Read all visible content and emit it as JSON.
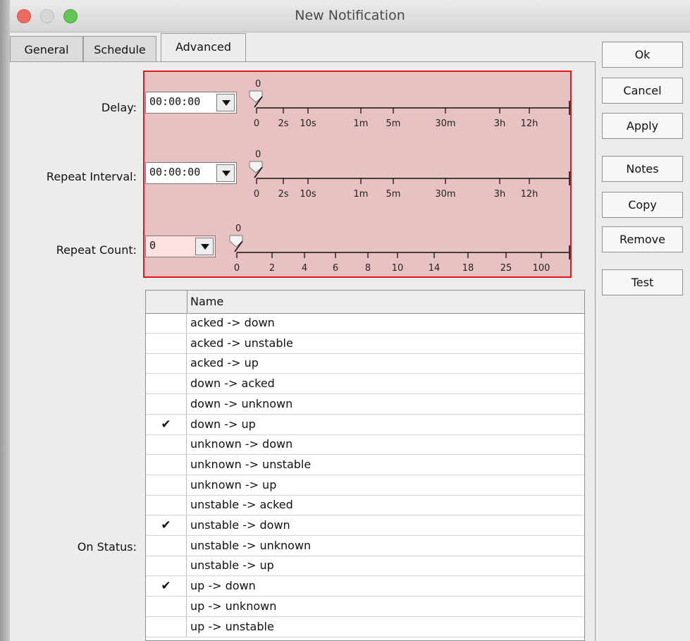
{
  "window": {
    "title": "New Notification"
  },
  "tabs": [
    "General",
    "Schedule",
    "Advanced"
  ],
  "buttons": {
    "ok": "Ok",
    "cancel": "Cancel",
    "apply": "Apply",
    "notes": "Notes",
    "copy": "Copy",
    "remove": "Remove",
    "test": "Test"
  },
  "fields": {
    "delay": {
      "label": "Delay:",
      "value": "00:00:00",
      "slider_value": "0",
      "ticks": [
        "0",
        "2s",
        "10s",
        "1m",
        "5m",
        "30m",
        "3h",
        "12h"
      ]
    },
    "repeat_interval": {
      "label": "Repeat Interval:",
      "value": "00:00:00",
      "slider_value": "0",
      "ticks": [
        "0",
        "2s",
        "10s",
        "1m",
        "5m",
        "30m",
        "3h",
        "12h"
      ]
    },
    "repeat_count": {
      "label": "Repeat Count:",
      "value": "0",
      "slider_value": "0",
      "ticks": [
        "0",
        "2",
        "4",
        "6",
        "8",
        "10",
        "14",
        "18",
        "25",
        "100"
      ]
    },
    "on_status": {
      "label": "On Status:"
    }
  },
  "status_table": {
    "header": "Name",
    "rows": [
      {
        "name": "acked -> down",
        "checked": false
      },
      {
        "name": "acked -> unstable",
        "checked": false
      },
      {
        "name": "acked -> up",
        "checked": false
      },
      {
        "name": "down -> acked",
        "checked": false
      },
      {
        "name": "down -> unknown",
        "checked": false
      },
      {
        "name": "down -> up",
        "checked": true
      },
      {
        "name": "unknown -> down",
        "checked": false
      },
      {
        "name": "unknown -> unstable",
        "checked": false
      },
      {
        "name": "unknown -> up",
        "checked": false
      },
      {
        "name": "unstable -> acked",
        "checked": false
      },
      {
        "name": "unstable -> down",
        "checked": true
      },
      {
        "name": "unstable -> unknown",
        "checked": false
      },
      {
        "name": "unstable -> up",
        "checked": false
      },
      {
        "name": "up -> down",
        "checked": true
      },
      {
        "name": "up -> unknown",
        "checked": false
      },
      {
        "name": "up -> unstable",
        "checked": false
      }
    ]
  },
  "colors": {
    "highlight_fill": "#e8c2c2",
    "highlight_border": "#e01818",
    "light_close": "#ed6a5e",
    "light_min": "#d6d6d6",
    "light_max": "#62c554"
  },
  "icons": {
    "check": "check-icon",
    "dropdown": "chevron-down-icon"
  }
}
